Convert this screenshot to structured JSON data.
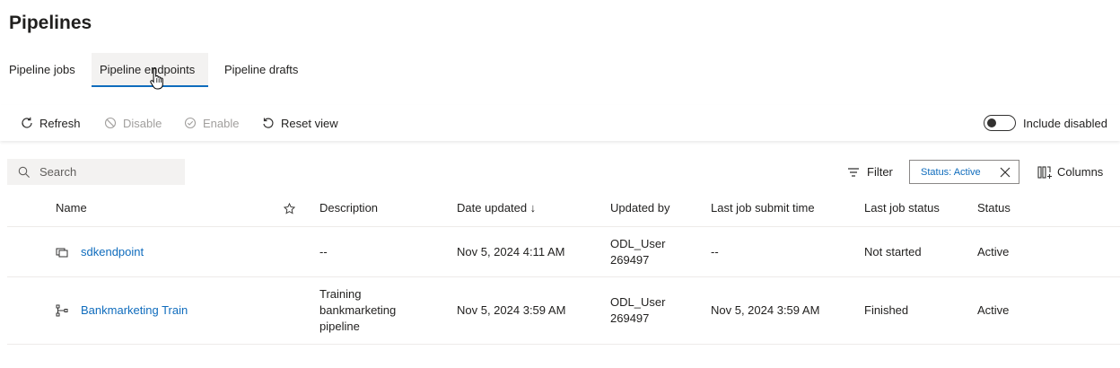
{
  "page": {
    "title": "Pipelines"
  },
  "tabs": [
    {
      "label": "Pipeline jobs",
      "active": false
    },
    {
      "label": "Pipeline endpoints",
      "active": true
    },
    {
      "label": "Pipeline drafts",
      "active": false
    }
  ],
  "toolbar": {
    "refresh_label": "Refresh",
    "disable_label": "Disable",
    "enable_label": "Enable",
    "reset_label": "Reset view",
    "include_disabled_label": "Include disabled",
    "include_disabled_on": false
  },
  "search": {
    "placeholder": "Search"
  },
  "filter": {
    "filter_label": "Filter",
    "chip_label": "Status: Active",
    "columns_label": "Columns"
  },
  "table": {
    "headers": {
      "name": "Name",
      "description": "Description",
      "date_updated": "Date updated ↓",
      "updated_by": "Updated by",
      "last_job_submit_time": "Last job submit time",
      "last_job_status": "Last job status",
      "status": "Status"
    },
    "rows": [
      {
        "icon": "endpoint-icon",
        "name": "sdkendpoint",
        "description": "--",
        "date_updated": "Nov 5, 2024 4:11 AM",
        "updated_by_1": "ODL_User",
        "updated_by_2": "269497",
        "last_job_submit_time": "--",
        "last_job_status": "Not started",
        "status": "Active"
      },
      {
        "icon": "pipeline-icon",
        "name": "Bankmarketing Train",
        "description_1": "Training",
        "description_2": "bankmarketing",
        "description_3": "pipeline",
        "date_updated": "Nov 5, 2024 3:59 AM",
        "updated_by_1": "ODL_User",
        "updated_by_2": "269497",
        "last_job_submit_time": "Nov 5, 2024 3:59 AM",
        "last_job_status": "Finished",
        "status": "Active"
      }
    ]
  },
  "colors": {
    "accent": "#0f6cbd",
    "text": "#201f1e",
    "disabled": "#a19f9d",
    "chip_border": "#8a8886"
  }
}
